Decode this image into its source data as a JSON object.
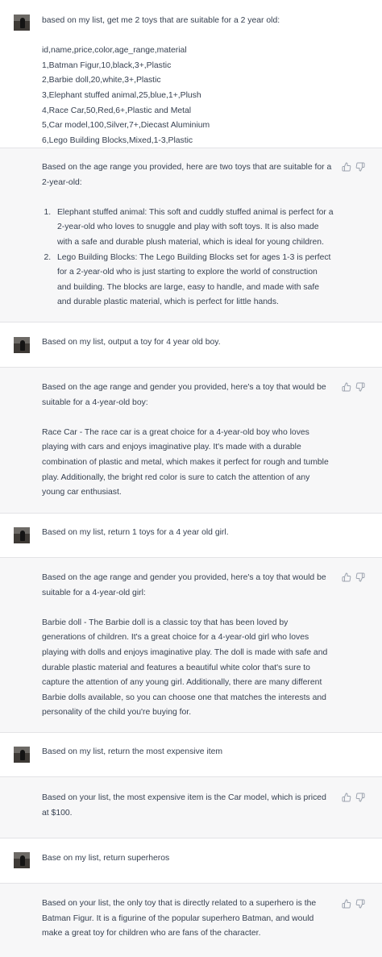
{
  "conversation": [
    {
      "role": "user",
      "paragraphs": [
        "based on  my list, get me 2 toys that are suitable for a 2 year old:"
      ],
      "csv_lines": [
        "id,name,price,color,age_range,material",
        "1,Batman Figur,10,black,3+,Plastic",
        "2,Barbie doll,20,white,3+,Plastic",
        "3,Elephant stuffed animal,25,blue,1+,Plush",
        "4,Race Car,50,Red,6+,Plastic and Metal",
        "5,Car model,100,Silver,7+,Diecast Aluminium",
        "6,Lego Building Blocks,Mixed,1-3,Plastic"
      ]
    },
    {
      "role": "assistant",
      "paragraphs": [
        "Based on the age range you provided, here are two toys that are suitable for a 2-year-old:"
      ],
      "list_items": [
        "Elephant stuffed animal: This soft and cuddly stuffed animal is perfect for a 2-year-old who loves to snuggle and play with soft toys. It is also made with a safe and durable plush material, which is ideal for young children.",
        "Lego Building Blocks: The Lego Building Blocks set for ages 1-3 is perfect for a 2-year-old who is just starting to explore the world of construction and building. The blocks are large, easy to handle, and made with safe and durable plastic material, which is perfect for little hands."
      ]
    },
    {
      "role": "user",
      "paragraphs": [
        "Based on my list, output a toy for 4 year old boy."
      ]
    },
    {
      "role": "assistant",
      "paragraphs": [
        "Based on the age range and gender you provided, here's a toy that would be suitable for a 4-year-old boy:",
        "Race Car - The race car is a great choice for a 4-year-old boy who loves playing with cars and enjoys imaginative play. It's made with a durable combination of plastic and metal, which makes it perfect for rough and tumble play. Additionally, the bright red color is sure to catch the attention of any young car enthusiast."
      ]
    },
    {
      "role": "user",
      "paragraphs": [
        "Based on my list, return 1 toys for a 4 year old girl."
      ]
    },
    {
      "role": "assistant",
      "paragraphs": [
        "Based on the age range and gender you provided, here's a toy that would be suitable for a 4-year-old girl:",
        "Barbie doll - The Barbie doll is a classic toy that has been loved by generations of children. It's a great choice for a 4-year-old girl who loves playing with dolls and enjoys imaginative play. The doll is made with safe and durable plastic material and features a beautiful white color that's sure to capture the attention of any young girl. Additionally, there are many different Barbie dolls available, so you can choose one that matches the interests and personality of the child you're buying for."
      ]
    },
    {
      "role": "user",
      "paragraphs": [
        "Based on my list, return the most expensive item"
      ]
    },
    {
      "role": "assistant",
      "paragraphs": [
        "Based on your list, the most expensive item is the Car model, which is priced at $100."
      ]
    },
    {
      "role": "user",
      "paragraphs": [
        "Base on my list, return superheros"
      ]
    },
    {
      "role": "assistant",
      "paragraphs": [
        "Based on your list, the only toy that is directly related to a superhero is the Batman Figur. It is a figurine of the popular superhero Batman, and would make a great toy for children who are fans of the character."
      ]
    }
  ],
  "colors": {
    "user_bg": "#ffffff",
    "assistant_bg": "#f7f7f8",
    "text": "#374151",
    "icon": "#9ca3af",
    "separator": "#e3e3e6"
  },
  "icons": {
    "user_avatar": "user-avatar-photo",
    "feedback_up": "thumbs-up-icon",
    "feedback_down": "thumbs-down-icon"
  }
}
